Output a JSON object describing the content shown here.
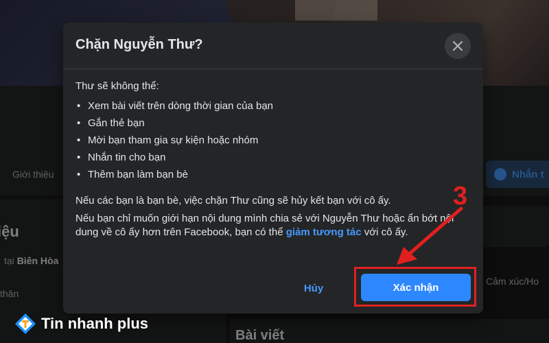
{
  "background": {
    "nav_tab": "Giới thiệu",
    "message_button": "Nhắn t",
    "intro_title": "iệu",
    "intro_line1_prefix": "tại ",
    "intro_line1_place": "Biên Hòa",
    "intro_line2": "thân",
    "feeling_text": "Cảm xúc/Ho",
    "posts_title": "Bài viết"
  },
  "dialog": {
    "title": "Chặn Nguyễn Thư?",
    "lead": "Thư sẽ không thể:",
    "items": [
      "Xem bài viết trên dòng thời gian của bạn",
      "Gắn thẻ bạn",
      "Mời bạn tham gia sự kiện hoặc nhóm",
      "Nhắn tin cho bạn",
      "Thêm bạn làm bạn bè"
    ],
    "para1": "Nếu các bạn là bạn bè, việc chặn Thư cũng sẽ hủy kết bạn với cô ấy.",
    "para2_before": "Nếu bạn chỉ muốn giới hạn nội dung mình chia sẻ với Nguyễn Thư hoặc ẩn bớt nội dung về cô ấy hơn trên Facebook, bạn có thể ",
    "para2_link": "giảm tương tác",
    "para2_after": " với cô ấy.",
    "cancel_label": "Hủy",
    "confirm_label": "Xác nhận"
  },
  "annotation": {
    "step_number": "3",
    "color": "#e02020"
  },
  "watermark": {
    "text": "Tin nhanh plus"
  },
  "colors": {
    "accent": "#2d88ff",
    "link": "#4599ff",
    "dialog_bg": "#242526"
  }
}
